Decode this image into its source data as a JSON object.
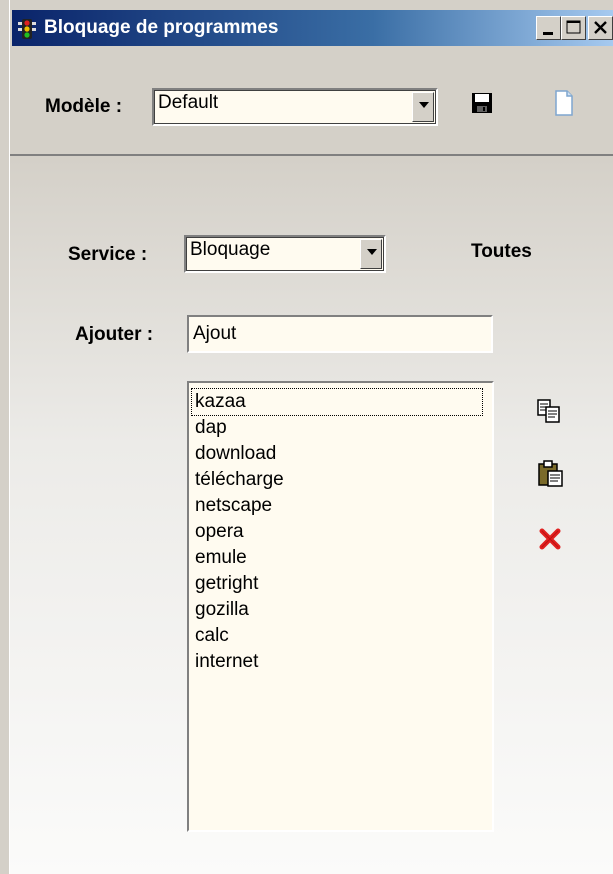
{
  "window": {
    "title": "Bloquage de programmes"
  },
  "titlebar_buttons": [
    "minimize-icon",
    "maximize-icon",
    "close-icon"
  ],
  "toolbar": {
    "template_label": "Modèle :",
    "template_value": "Default",
    "save_icon": "floppy-save-icon",
    "new_icon": "new-document-icon"
  },
  "form": {
    "service_label": "Service :",
    "service_value": "Bloquage",
    "all_label": "Toutes",
    "add_label": "Ajouter :",
    "add_value": "Ajout"
  },
  "list": {
    "items": [
      "kazaa",
      "dap",
      "download",
      "télécharge",
      "netscape",
      "opera",
      "emule",
      "getright",
      "gozilla",
      "calc",
      "internet"
    ]
  },
  "actions": [
    "copy-icon",
    "paste-icon",
    "delete-icon"
  ],
  "colors": {
    "field_bg": "#fffbf0",
    "title_start": "#0a246a",
    "title_end": "#a6caf0",
    "delete_red": "#e02020"
  }
}
